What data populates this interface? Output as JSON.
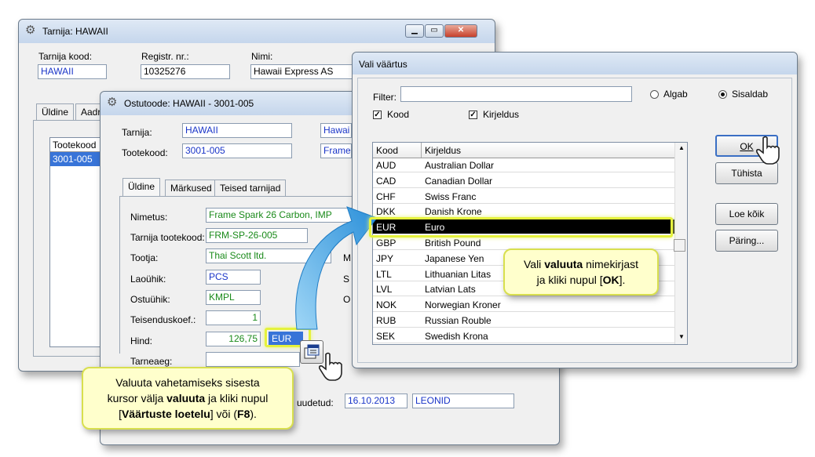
{
  "supplier_win": {
    "title": "Tarnija: HAWAII",
    "labels": {
      "code": "Tarnija kood:",
      "regno": "Registr. nr.:",
      "name": "Nimi:"
    },
    "values": {
      "code": "HAWAII",
      "regno": "10325276",
      "name": "Hawaii Express AS"
    },
    "tabs": [
      "Üldine",
      "Aadr"
    ],
    "list_header": "Tootekood",
    "list_row": "3001-005"
  },
  "product_win": {
    "title": "Ostutoode: HAWAII - 3001-005",
    "labels": {
      "supplier": "Tarnija:",
      "product_code": "Tootekood:",
      "name": "Nimetus:",
      "supplier_code": "Tarnija tootekood:",
      "manufacturer": "Tootja:",
      "stock_unit": "Laoühik:",
      "purchase_unit": "Ostuühik:",
      "conversion": "Teisenduskoef.:",
      "price": "Hind:",
      "lead_time": "Tarneaeg:",
      "changed": "uudetud:",
      "m": "M",
      "s": "S",
      "o": "O"
    },
    "values": {
      "supplier": "HAWAII",
      "supplier_name": "Hawai",
      "product_code": "3001-005",
      "product_name": "Frame",
      "name": "Frame Spark 26 Carbon, IMP",
      "supplier_code": "FRM-SP-26-005",
      "manufacturer": "Thai Scott ltd.",
      "stock_unit": "PCS",
      "purchase_unit": "KMPL",
      "conversion": "1",
      "price": "126,75",
      "currency": "EUR",
      "lead_time": "",
      "changed_date": "16.10.2013",
      "changed_user": "LEONID"
    },
    "tabs": [
      "Üldine",
      "Märkused",
      "Teised tarnijad"
    ]
  },
  "picker_win": {
    "title": "Vali väärtus",
    "filter_label": "Filter:",
    "filter_value": "",
    "radio_starts": "Algab",
    "radio_contains": "Sisaldab",
    "check_code": "Kood",
    "check_desc": "Kirjeldus",
    "col_code": "Kood",
    "col_desc": "Kirjeldus",
    "rows": [
      {
        "code": "AUD",
        "desc": "Australian Dollar"
      },
      {
        "code": "CAD",
        "desc": "Canadian Dollar"
      },
      {
        "code": "CHF",
        "desc": "Swiss Franc"
      },
      {
        "code": "DKK",
        "desc": "Danish Krone"
      },
      {
        "code": "EUR",
        "desc": "Euro"
      },
      {
        "code": "GBP",
        "desc": "British Pound"
      },
      {
        "code": "JPY",
        "desc": "Japanese Yen"
      },
      {
        "code": "LTL",
        "desc": "Lithuanian Litas"
      },
      {
        "code": "LVL",
        "desc": "Latvian Lats"
      },
      {
        "code": "NOK",
        "desc": "Norwegian Kroner"
      },
      {
        "code": "RUB",
        "desc": "Russian Rouble"
      },
      {
        "code": "SEK",
        "desc": "Swedish Krona"
      }
    ],
    "selected_code": "EUR",
    "buttons": {
      "ok": "OK",
      "cancel": "Tühista",
      "load_all": "Loe kõik",
      "query": "Päring..."
    }
  },
  "callouts": {
    "left": {
      "l1": "Valuuta vahetamiseks sisesta",
      "l2a": "kursor välja ",
      "l2b": "valuuta",
      "l2c": " ja kliki nupul",
      "l3a": "[",
      "l3b": "Väärtuste loetelu",
      "l3c": "] või (",
      "l3d": "F8",
      "l3e": ")."
    },
    "right": {
      "l1a": "Vali ",
      "l1b": "valuuta",
      "l1c": " nimekirjast",
      "l2a": "ja kliki nupul [",
      "l2b": "OK",
      "l2c": "]."
    }
  },
  "colors": {
    "accent_yellow": "#e5f23c",
    "callout_bg": "#ffffcc",
    "arrow_blue": "#3aa4e4",
    "value_blue": "#1a35c8",
    "value_green": "#1a8a1a"
  }
}
